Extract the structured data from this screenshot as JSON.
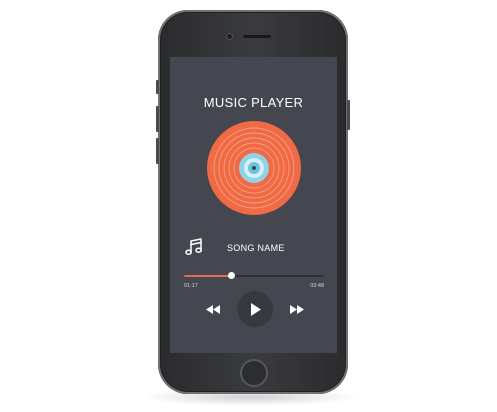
{
  "app": {
    "title": "MUSIC PLAYER"
  },
  "track": {
    "name": "SONG NAME",
    "elapsed": "01:17",
    "duration": "03:48",
    "progress": 0.34
  },
  "icons": {
    "vinyl": "vinyl-record-icon",
    "note": "music-note-icon",
    "rewind": "rewind-icon",
    "play": "play-icon",
    "forward": "fast-forward-icon"
  },
  "colors": {
    "screen_bg": "#44474f",
    "accent": "#e86a4c",
    "vinyl_orange": "#ef6a45",
    "vinyl_label": "#8fd3e8",
    "text": "#ffffff"
  }
}
